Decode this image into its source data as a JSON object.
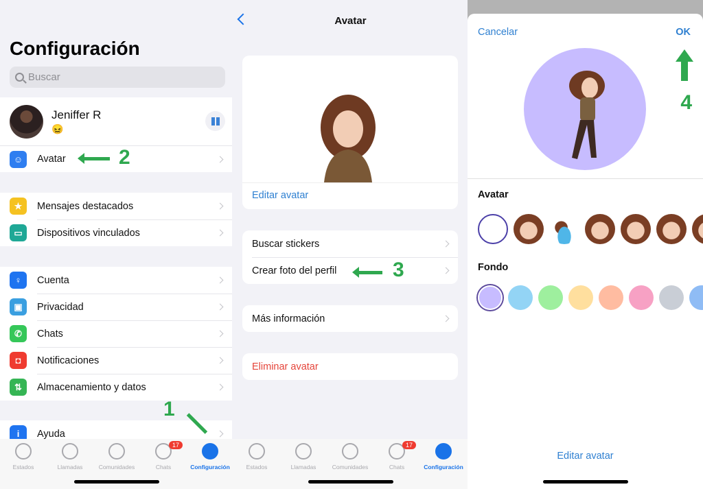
{
  "settings": {
    "title": "Configuración",
    "search_placeholder": "Buscar",
    "profile": {
      "name": "Jeniffer R",
      "status_emoji": "😖"
    },
    "avatar_row": {
      "label": "Avatar",
      "icon": "avatar-icon",
      "color": "#2f7ef0"
    },
    "group1": [
      {
        "label": "Mensajes destacados",
        "icon": "star-icon",
        "color": "#f5c221"
      },
      {
        "label": "Dispositivos vinculados",
        "icon": "laptop-icon",
        "color": "#1fa896"
      }
    ],
    "group2": [
      {
        "label": "Cuenta",
        "icon": "key-icon",
        "color": "#1f74f0"
      },
      {
        "label": "Privacidad",
        "icon": "lock-icon",
        "color": "#3a9fe0"
      },
      {
        "label": "Chats",
        "icon": "whatsapp-icon",
        "color": "#35c759"
      },
      {
        "label": "Notificaciones",
        "icon": "notification-icon",
        "color": "#ef3b30"
      },
      {
        "label": "Almacenamiento y datos",
        "icon": "arrows-updown-icon",
        "color": "#35b554"
      }
    ],
    "group3": [
      {
        "label": "Ayuda",
        "icon": "info-icon",
        "color": "#1f74f0"
      }
    ]
  },
  "tabbar": {
    "tabs": [
      {
        "label": "Estados",
        "icon": "status-icon"
      },
      {
        "label": "Llamadas",
        "icon": "phone-icon"
      },
      {
        "label": "Comunidades",
        "icon": "communities-icon"
      },
      {
        "label": "Chats",
        "icon": "chats-icon",
        "badge": "17"
      },
      {
        "label": "Configuración",
        "icon": "settings-icon",
        "active": true
      }
    ]
  },
  "avatar_page": {
    "title": "Avatar",
    "edit_label": "Editar avatar",
    "menu1": [
      "Buscar stickers",
      "Crear foto del perfil"
    ],
    "menu2": [
      "Más información"
    ],
    "delete_label": "Eliminar avatar"
  },
  "photo_editor": {
    "cancel_label": "Cancelar",
    "ok_label": "OK",
    "avatar_section": "Avatar",
    "background_section": "Fondo",
    "selected_background": "#c7bcff",
    "backgrounds": [
      "#c7bcff",
      "#93d4f5",
      "#9eef9e",
      "#ffdf9e",
      "#ffbca1",
      "#f7a1c4",
      "#c9ced6",
      "#8fbcf5"
    ],
    "edit_label": "Editar avatar"
  },
  "annotations": {
    "step1": "1",
    "step2": "2",
    "step3": "3",
    "step4": "4",
    "color": "#2fa84f"
  }
}
